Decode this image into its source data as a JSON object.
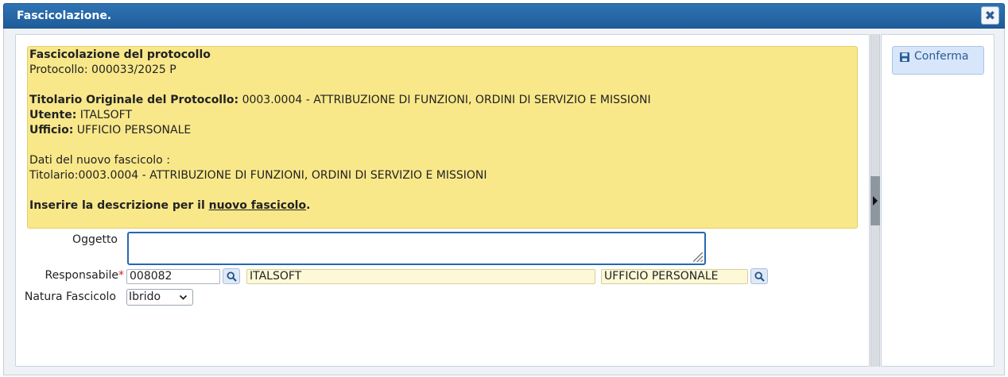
{
  "window": {
    "title": "Fascicolazione.",
    "close_icon": "close-icon"
  },
  "info": {
    "heading": "Fascicolazione del protocollo",
    "protocollo": "Protocollo: 000033/2025 P",
    "titolario_label": "Titolario Originale del Protocollo:",
    "titolario_value": " 0003.0004 - ATTRIBUZIONE DI FUNZIONI, ORDINI DI SERVIZIO E MISSIONI",
    "utente_label": "Utente:",
    "utente_value": " ITALSOFT",
    "ufficio_label": "Ufficio:",
    "ufficio_value": " UFFICIO PERSONALE",
    "nuovo_heading": "Dati del nuovo fascicolo :",
    "nuovo_titolario": "Titolario:0003.0004 - ATTRIBUZIONE DI FUNZIONI, ORDINI DI SERVIZIO E MISSIONI",
    "prompt_before": "Inserire la descrizione per il ",
    "prompt_link": "nuovo fascicolo",
    "prompt_after": "."
  },
  "form": {
    "oggetto_label": "Oggetto",
    "oggetto_value": "",
    "responsabile_label": "Responsabile",
    "required_mark": "*",
    "responsabile_code": "008082",
    "responsabile_name": "ITALSOFT",
    "responsabile_office": "UFFICIO PERSONALE",
    "natura_label": "Natura Fascicolo",
    "natura_value": "Ibrido"
  },
  "side": {
    "confirm_label": "Conferma",
    "confirm_icon": "save-icon"
  },
  "colors": {
    "titlebar": "#1f5c99",
    "info_bg": "#f9e88a",
    "focus_border": "#2468b3",
    "confirm_bg": "#d8e6fb"
  }
}
